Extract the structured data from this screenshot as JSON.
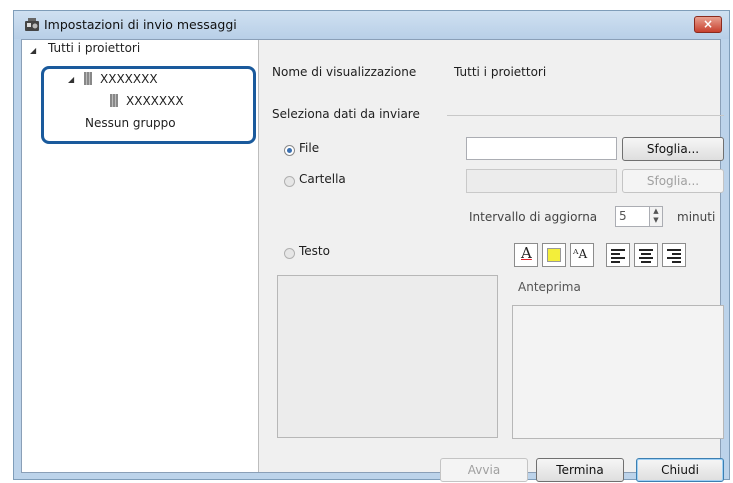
{
  "window": {
    "title": "Impostazioni di invio messaggi",
    "close_label": "×"
  },
  "tree": {
    "root": "Tutti i proiettori",
    "projector1": "XXXXXXX",
    "projector2": "XXXXXXX",
    "no_group": "Nessun gruppo"
  },
  "display_name": {
    "label": "Nome di visualizzazione",
    "value": "Tutti i proiettori"
  },
  "select_data": {
    "label": "Seleziona dati da inviare"
  },
  "file": {
    "label": "File",
    "value": "",
    "browse_label": "Sfoglia...",
    "selected": true
  },
  "folder": {
    "label": "Cartella",
    "value": "",
    "browse_label": "Sfoglia...",
    "selected": false
  },
  "interval": {
    "label": "Intervallo di aggiorna",
    "value": "5",
    "unit": "minuti"
  },
  "text": {
    "label": "Testo",
    "selected": false,
    "value": ""
  },
  "format": {
    "font_color_glyph": "A",
    "font_glyph": "ᴬA"
  },
  "preview": {
    "label": "Anteprima"
  },
  "actions": {
    "start_label": "Avvia",
    "stop_label": "Termina",
    "close_label": "Chiudi"
  }
}
